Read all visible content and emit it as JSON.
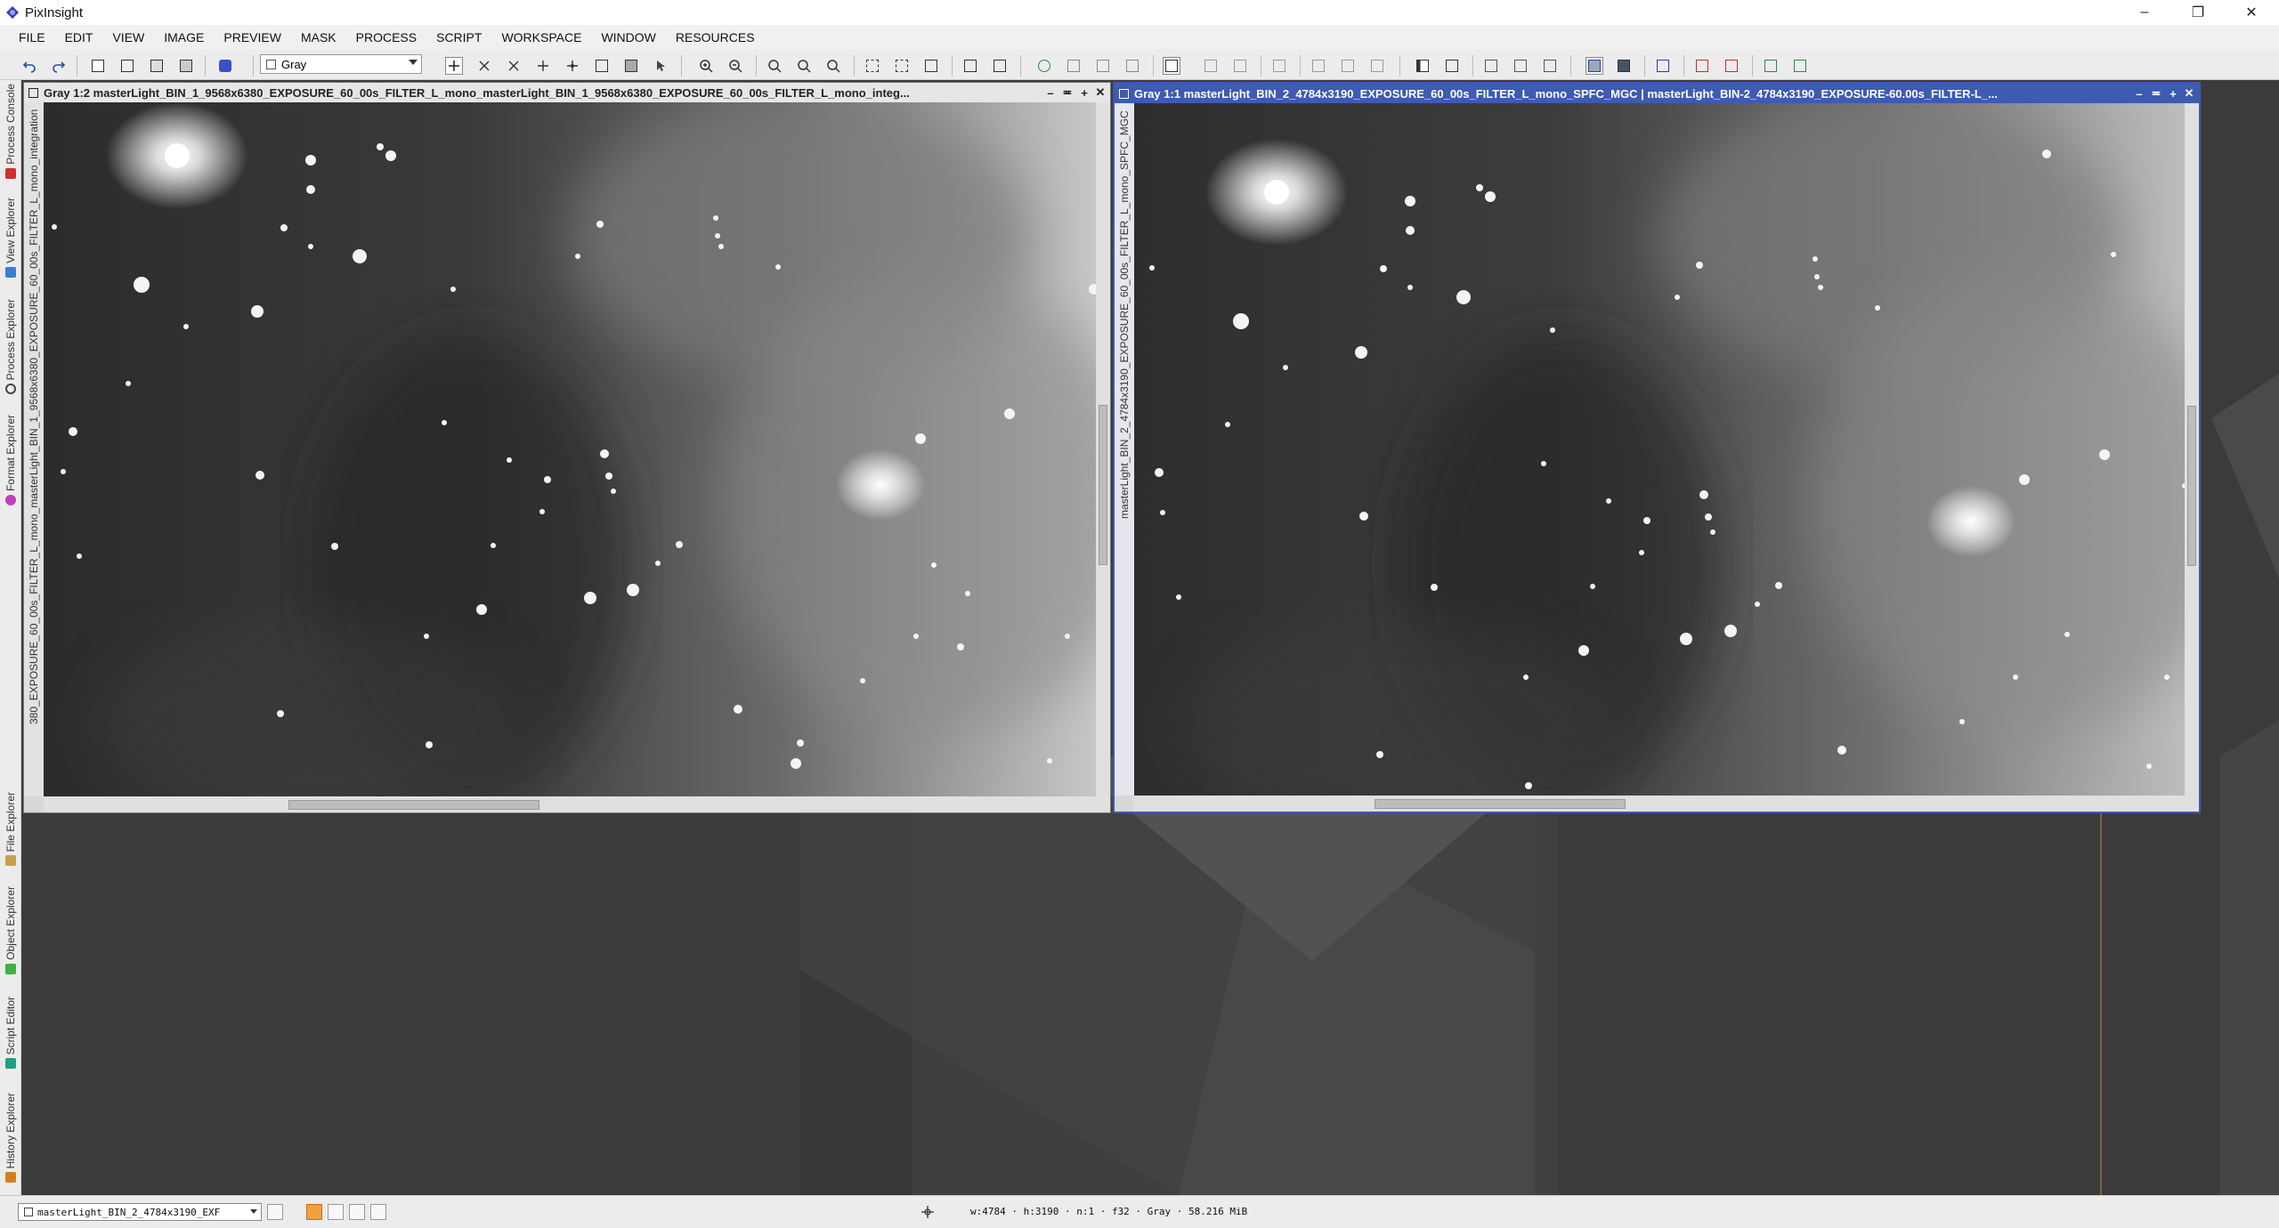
{
  "app": {
    "title": "PixInsight",
    "window_controls": [
      "–",
      "❐",
      "✕"
    ]
  },
  "menu": [
    "FILE",
    "EDIT",
    "VIEW",
    "IMAGE",
    "PREVIEW",
    "MASK",
    "PROCESS",
    "SCRIPT",
    "WORKSPACE",
    "WINDOW",
    "RESOURCES"
  ],
  "toolbar": {
    "color_mode_value": "Gray",
    "accent": "#3d5bb0"
  },
  "left_dock": {
    "tabs": [
      {
        "label": "Process Console",
        "icon": "console-icon",
        "color": "#d03030"
      },
      {
        "label": "View Explorer",
        "icon": "view-explorer-icon",
        "color": "#3a7fd0"
      },
      {
        "label": "Process Explorer",
        "icon": "gear-icon",
        "color": "#444444"
      },
      {
        "label": "Format Explorer",
        "icon": "format-icon",
        "color": "#c040c0"
      },
      {
        "label": "File Explorer",
        "icon": "file-icon",
        "color": "#c8a050"
      },
      {
        "label": "Object Explorer",
        "icon": "object-icon",
        "color": "#40b040"
      },
      {
        "label": "Script Editor",
        "icon": "script-icon",
        "color": "#20a080"
      },
      {
        "label": "History Explorer",
        "icon": "history-icon",
        "color": "#d08020"
      }
    ]
  },
  "windows": [
    {
      "title": "Gray 1:2 masterLight_BIN_1_9568x6380_EXPOSURE_60_00s_FILTER_L_mono_masterLight_BIN_1_9568x6380_EXPOSURE_60_00s_FILTER_L_mono_integ...",
      "side_label": "380_EXPOSURE_60_00s_FILTER_L_mono_masterLight_BIN_1_9568x6380_EXPOSURE_60_00s_FILTER_L_mono_integration",
      "active": false
    },
    {
      "title": "Gray 1:1 masterLight_BIN_2_4784x3190_EXPOSURE_60_00s_FILTER_L_mono_SPFC_MGC | masterLight_BIN-2_4784x3190_EXPOSURE-60.00s_FILTER-L_...",
      "side_label": "masterLight_BIN_2_4784x3190_EXPOSURE_60_00s_FILTER_L_mono_SPFC_MGC",
      "active": true
    }
  ],
  "status": {
    "view_select": "masterLight_BIN_2_4784x3190_EXF",
    "image_info": "w:4784 · h:3190 · n:1 · f32 · Gray · 58.216 MiB"
  }
}
